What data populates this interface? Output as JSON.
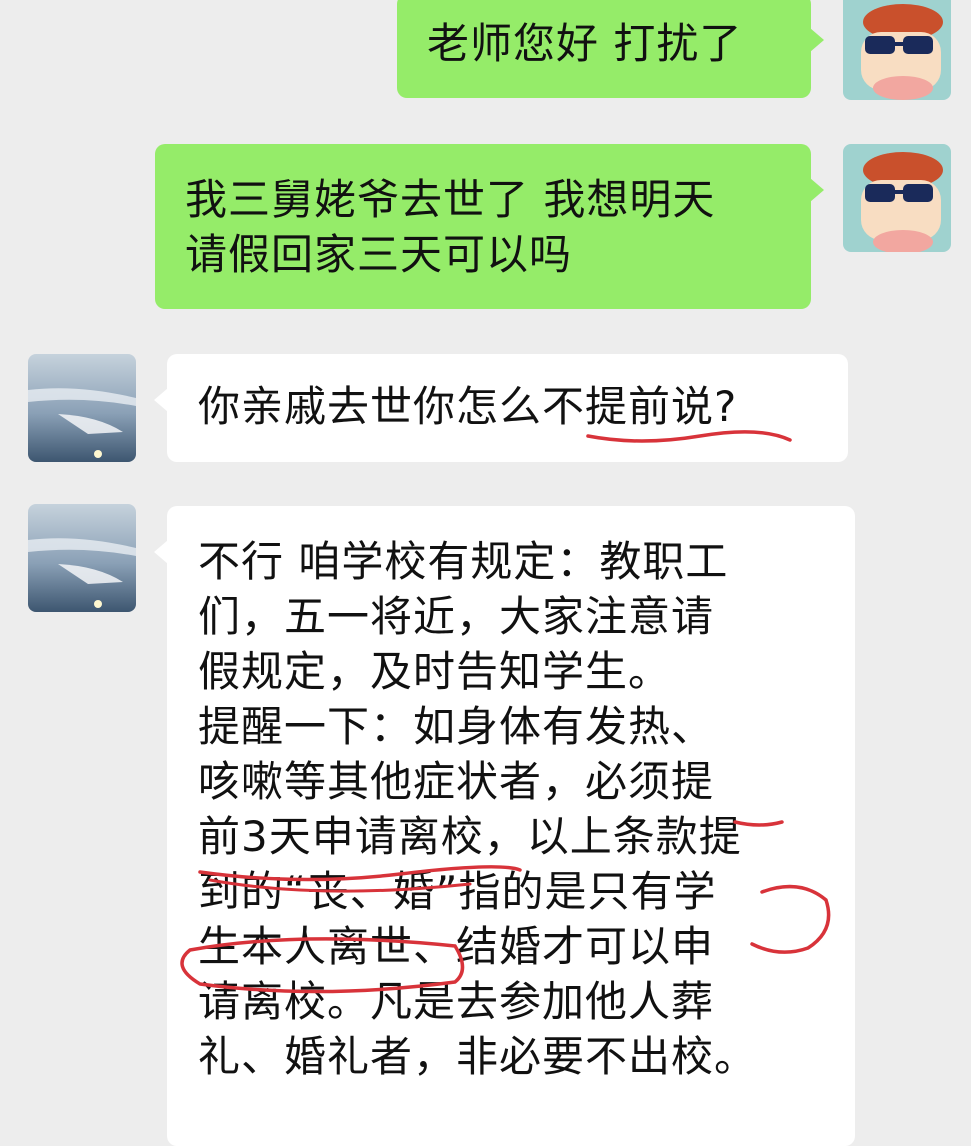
{
  "chat": {
    "messages": [
      {
        "sender": "self",
        "text": "老师您好 打扰了"
      },
      {
        "sender": "self",
        "text": "我三舅姥爷去世了 我想明天\n请假回家三天可以吗"
      },
      {
        "sender": "other",
        "text": "你亲戚去世你怎么不提前说?"
      },
      {
        "sender": "other",
        "lines": [
          "不行 咱学校有规定：教职工",
          "们，五一将近，大家注意请",
          "假规定，及时告知学生。",
          "提醒一下：如身体有发热、",
          "咳嗽等其他症状者，必须提",
          "前3天申请离校，以上条款提",
          "到的“丧、婚”指的是只有学",
          "生本人离世、结婚才可以申",
          "请离校。凡是去参加他人葬",
          "礼、婚礼者，非必要不出校。"
        ]
      }
    ]
  },
  "avatars": {
    "self": "cartoon-boy-sunglasses-icon",
    "other": "sky-landscape-avatar-icon"
  },
  "colors": {
    "background": "#ededed",
    "self_bubble": "#95ec69",
    "other_bubble": "#ffffff",
    "annotation": "#d8333a"
  }
}
